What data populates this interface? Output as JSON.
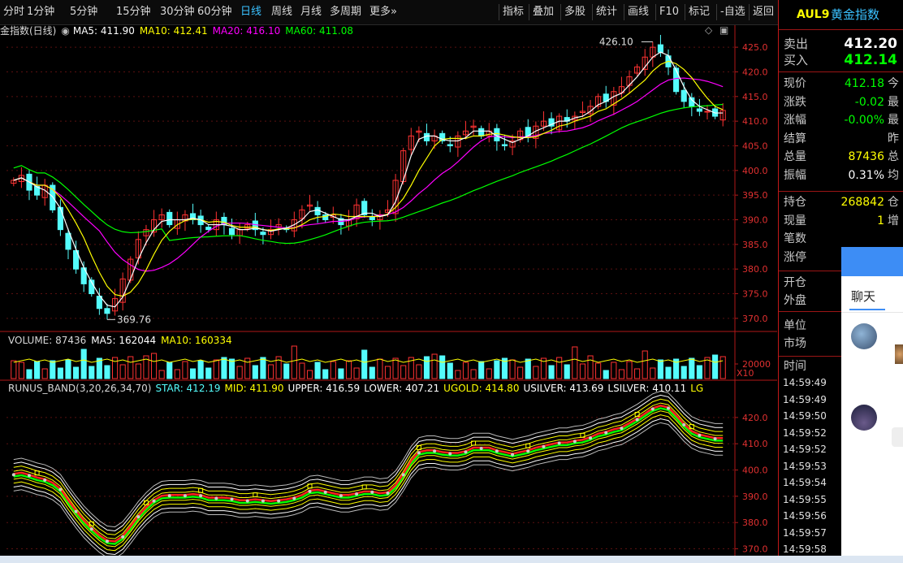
{
  "toolbar": {
    "periods": [
      "分时",
      "1分钟",
      "5分钟",
      "15分钟",
      "30分钟",
      "60分钟",
      "日线",
      "周线",
      "月线",
      "多周期",
      "更多»"
    ],
    "selected": "日线",
    "tools": [
      "指标",
      "叠加",
      "多股",
      "统计",
      "画线",
      "F10",
      "标记",
      "-自选",
      "返回"
    ]
  },
  "legend": {
    "title": "金指数(日线)",
    "ma5": "MA5: 411.90",
    "ma10": "MA10: 412.41",
    "ma20": "MA20: 416.10",
    "ma60": "MA60: 411.08",
    "colors": {
      "ma5": "#ffffff",
      "ma10": "#ffff00",
      "ma20": "#ff00ff",
      "ma60": "#00ff00",
      "up": "#ff3232",
      "down": "#54fcfc"
    }
  },
  "annotations": {
    "high": "426.10",
    "low": "369.76"
  },
  "price_axis": [
    "425.0",
    "420.0",
    "415.0",
    "410.0",
    "405.0",
    "400.0",
    "395.0",
    "390.0",
    "385.0",
    "380.0",
    "375.0",
    "370.0"
  ],
  "volume": {
    "label": "VOLUME: 87436",
    "ma5": "MA5: 162044",
    "ma10": "MA10: 160334",
    "axis": "20000",
    "unit": "X10"
  },
  "band": {
    "title": "RUNUS_BAND(3,20,26,34,70)",
    "star": "STAR: 412.19",
    "mid": "MID: 411.90",
    "upper": "UPPER: 416.59",
    "lower": "LOWER: 407.21",
    "ugold": "UGOLD: 414.80",
    "usilver": "USILVER: 413.69",
    "lsilver": "LSILVER: 410.11",
    "lg": "LG",
    "axis": [
      "420.0",
      "410.0",
      "400.0",
      "390.0",
      "380.0",
      "370.0"
    ]
  },
  "chart_data": {
    "type": "candlestick",
    "title": "金指数(日线)",
    "ylim": [
      368,
      427
    ],
    "ohlc_summary": {
      "high": 426.1,
      "low": 369.76,
      "last_close": 412.18
    },
    "ma_last": {
      "MA5": 411.9,
      "MA10": 412.41,
      "MA20": 416.1,
      "MA60": 411.08
    },
    "close_path": [
      398,
      399,
      396,
      395,
      397,
      392,
      388,
      384,
      380,
      377,
      375,
      372,
      371,
      374,
      378,
      382,
      386,
      388,
      390,
      391,
      389,
      390,
      391,
      390,
      389,
      388,
      390,
      389,
      387,
      388,
      389,
      388,
      387,
      388,
      389,
      388,
      390,
      392,
      393,
      391,
      390,
      391,
      389,
      390,
      393,
      391,
      390,
      391,
      392,
      398,
      404,
      407,
      408,
      406,
      407,
      406,
      405,
      407,
      408,
      409,
      407,
      408,
      406,
      405,
      406,
      408,
      407,
      409,
      410,
      409,
      411,
      410,
      411,
      412,
      413,
      415,
      414,
      416,
      417,
      419,
      421,
      423,
      425,
      424,
      421,
      416,
      414,
      413,
      412,
      412,
      411,
      412
    ]
  },
  "right": {
    "code": "AUL9",
    "name": "黄金指数",
    "sell_label": "卖出",
    "sell": "412.20",
    "buy_label": "买入",
    "buy": "412.14",
    "rows": [
      {
        "l": "现价",
        "v": "412.18",
        "c": "#00ff00",
        "r": "今"
      },
      {
        "l": "涨跌",
        "v": "-0.02",
        "c": "#00ff00",
        "r": "最"
      },
      {
        "l": "涨幅",
        "v": "-0.00%",
        "c": "#00ff00",
        "r": "最"
      },
      {
        "l": "结算",
        "v": "",
        "c": "#ffffff",
        "r": "昨"
      },
      {
        "l": "总量",
        "v": "87436",
        "c": "#ffff00",
        "r": "总"
      },
      {
        "l": "振幅",
        "v": "0.31%",
        "c": "#ffffff",
        "r": "均"
      }
    ],
    "rows2": [
      {
        "l": "持仓",
        "v": "268842",
        "c": "#ffff00",
        "r": "仓"
      },
      {
        "l": "现量",
        "v": "1",
        "c": "#ffff00",
        "r": "增"
      },
      {
        "l": "笔数",
        "v": "",
        "c": "#ffffff",
        "r": ""
      },
      {
        "l": "涨停",
        "v": "",
        "c": "#ffffff",
        "r": ""
      }
    ],
    "rows3": [
      "开仓",
      "外盘"
    ],
    "rows4": [
      "单位",
      "市场"
    ],
    "time_label": "时间",
    "times": [
      "14:59:49",
      "14:59:49",
      "14:59:50",
      "14:59:52",
      "14:59:52",
      "14:59:53",
      "14:59:54",
      "14:59:55",
      "14:59:56",
      "14:59:57",
      "14:59:58"
    ]
  },
  "chat": {
    "tab": "聊天"
  }
}
